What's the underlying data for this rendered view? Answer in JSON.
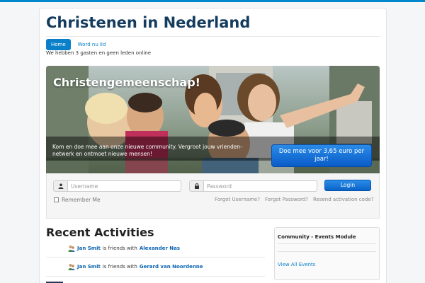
{
  "site": {
    "title": "Christenen in Nederland"
  },
  "nav": {
    "items": [
      {
        "label": "Home",
        "active": true
      },
      {
        "label": "Word nu lid",
        "active": false
      }
    ]
  },
  "online_text": "We hebben 3 gasten en geen leden online",
  "hero": {
    "title": "Christengemeenschap!",
    "text": "Kom en doe mee aan onze nieuwe community. Vergroot jouw vrienden-netwerk en ontmoet nieuwe mensen!",
    "cta": "Doe mee voor 3,65 euro per jaar!"
  },
  "login": {
    "username_placeholder": "Username",
    "password_placeholder": "Password",
    "login_label": "Login",
    "remember_label": "Remember Me",
    "forgot_username": "Forgot Username?",
    "forgot_password": "Forgot Password?",
    "resend_activation": "Resend activation code?"
  },
  "recent": {
    "title": "Recent Activities",
    "items": [
      {
        "actor": "Jan Smit",
        "verb": "is friends with",
        "target": "Alexander Nas"
      },
      {
        "actor": "Jan Smit",
        "verb": "is friends with",
        "target": "Gerard van Noordenne"
      }
    ]
  },
  "module": {
    "title": "Community - Events Module",
    "link": "View All Events"
  },
  "colors": {
    "accent": "#0a80c8",
    "title": "#143c5f",
    "cta": "#0a5cc8"
  },
  "icons": {
    "user": "user-icon",
    "lock": "lock-icon",
    "friends": "friends-icon"
  }
}
